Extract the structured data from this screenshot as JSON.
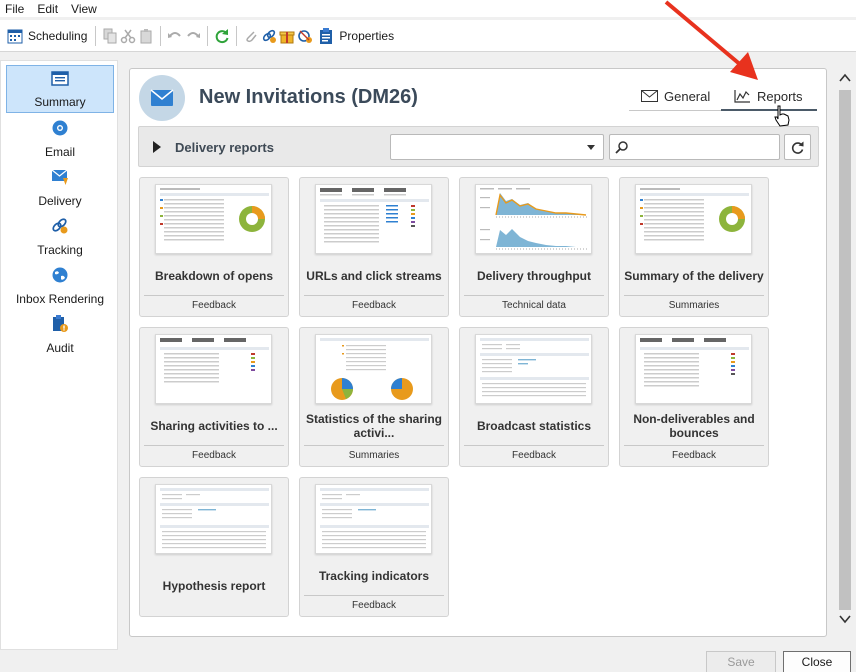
{
  "menu": {
    "file": "File",
    "edit": "Edit",
    "view": "View"
  },
  "toolbar": {
    "scheduling_label": "Scheduling",
    "properties_label": "Properties"
  },
  "nav": {
    "items": [
      {
        "label": "Summary",
        "icon": "summary-icon"
      },
      {
        "label": "Email",
        "icon": "email-icon"
      },
      {
        "label": "Delivery",
        "icon": "delivery-icon"
      },
      {
        "label": "Tracking",
        "icon": "tracking-icon"
      },
      {
        "label": "Inbox Rendering",
        "icon": "globe-icon"
      },
      {
        "label": "Audit",
        "icon": "audit-icon"
      }
    ]
  },
  "header": {
    "title": "New Invitations (DM26)"
  },
  "tabs": {
    "general": "General",
    "reports": "Reports"
  },
  "section": {
    "title": "Delivery reports",
    "dropdown_value": "",
    "search_value": ""
  },
  "cards": [
    {
      "title": "Breakdown of opens",
      "category": "Feedback"
    },
    {
      "title": "URLs and click streams",
      "category": "Feedback"
    },
    {
      "title": "Delivery throughput",
      "category": "Technical data"
    },
    {
      "title": "Summary of the delivery",
      "category": "Summaries"
    },
    {
      "title": "Sharing activities to ...",
      "category": "Feedback"
    },
    {
      "title": "Statistics of the sharing activi...",
      "category": "Summaries"
    },
    {
      "title": "Broadcast statistics",
      "category": "Feedback"
    },
    {
      "title": "Non-deliverables and bounces",
      "category": "Feedback"
    },
    {
      "title": "Hypothesis report",
      "category": ""
    },
    {
      "title": "Tracking indicators",
      "category": "Feedback"
    }
  ],
  "footer": {
    "save": "Save",
    "close": "Close"
  },
  "colors": {
    "accent": "#2f80d1",
    "active_nav": "#cde5fb",
    "highlight_arrow": "#e8321e"
  }
}
